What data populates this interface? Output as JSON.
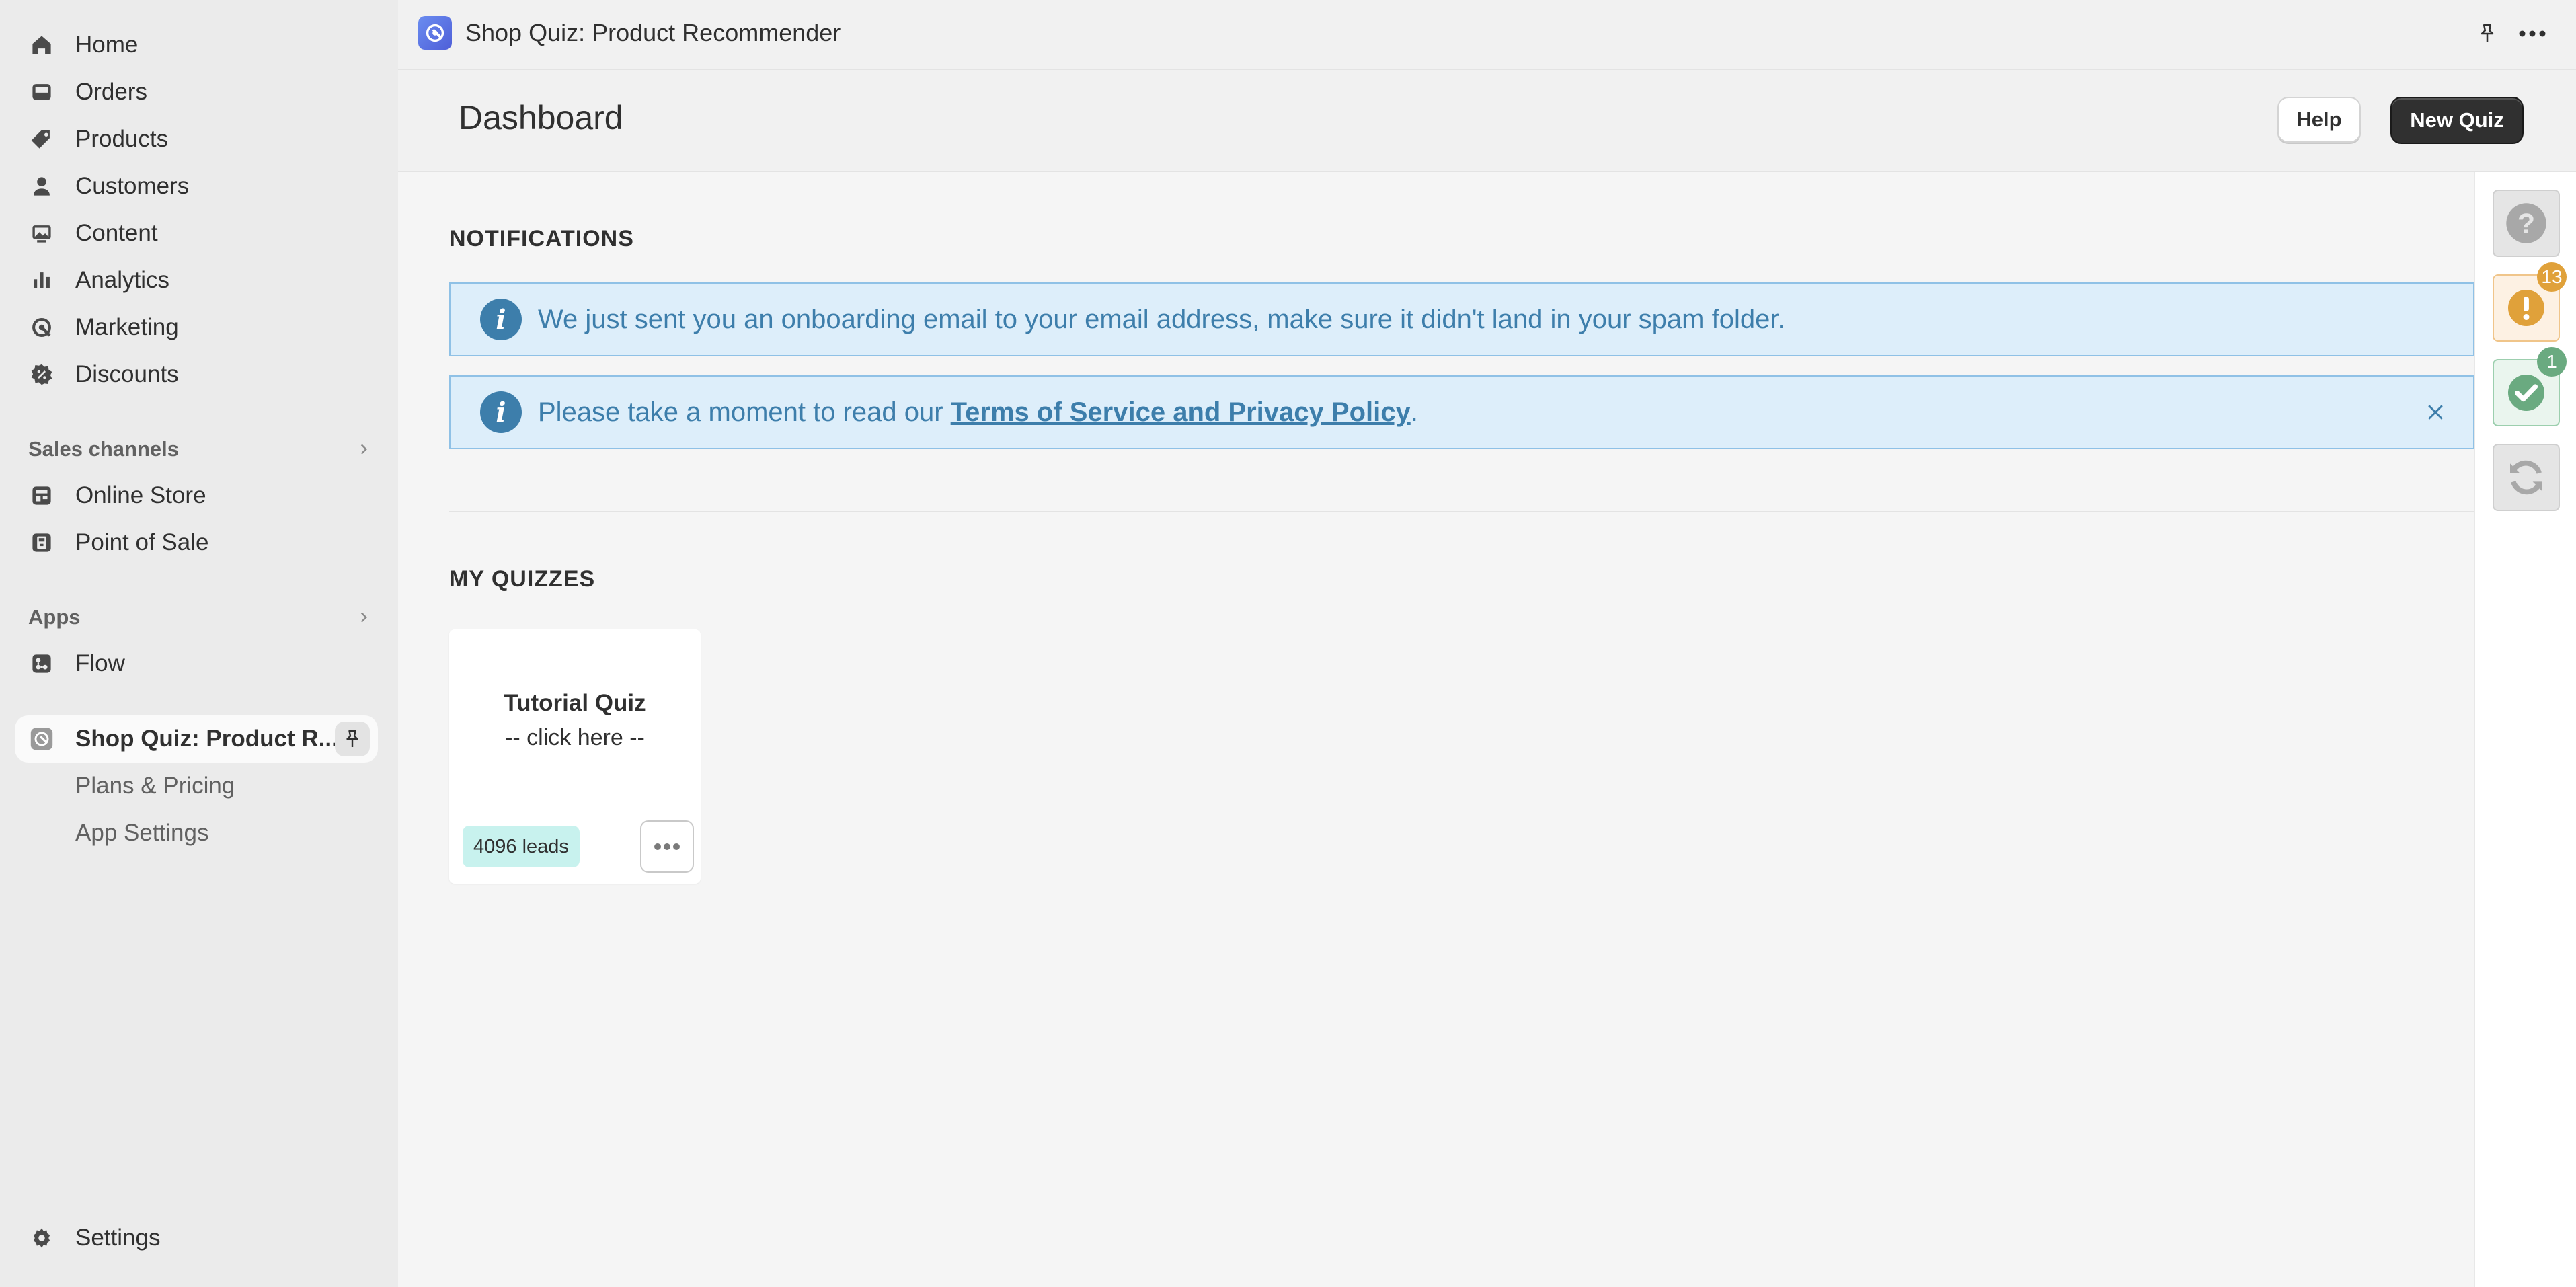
{
  "sidebar": {
    "nav": [
      {
        "label": "Home",
        "icon": "home-icon"
      },
      {
        "label": "Orders",
        "icon": "inbox-icon"
      },
      {
        "label": "Products",
        "icon": "tag-icon"
      },
      {
        "label": "Customers",
        "icon": "person-icon"
      },
      {
        "label": "Content",
        "icon": "image-icon"
      },
      {
        "label": "Analytics",
        "icon": "bar-chart-icon"
      },
      {
        "label": "Marketing",
        "icon": "target-icon"
      },
      {
        "label": "Discounts",
        "icon": "discount-icon"
      }
    ],
    "sales_channels": {
      "heading": "Sales channels",
      "items": [
        {
          "label": "Online Store",
          "icon": "store-icon"
        },
        {
          "label": "Point of Sale",
          "icon": "pos-icon"
        }
      ]
    },
    "apps": {
      "heading": "Apps",
      "items": [
        {
          "label": "Flow",
          "icon": "flow-icon"
        }
      ]
    },
    "current_app": {
      "label": "Shop Quiz: Product R...",
      "subitems": [
        {
          "label": "Plans & Pricing"
        },
        {
          "label": "App Settings"
        }
      ]
    },
    "settings_label": "Settings"
  },
  "topbar": {
    "app_title": "Shop Quiz: Product Recommender"
  },
  "header": {
    "title": "Dashboard",
    "help_label": "Help",
    "new_quiz_label": "New Quiz"
  },
  "notifications": {
    "heading": "NOTIFICATIONS",
    "items": [
      {
        "text": "We just sent you an onboarding email to your email address, make sure it didn't land in your spam folder."
      },
      {
        "prefix": "Please take a moment to read our ",
        "link": "Terms of Service and Privacy Policy",
        "suffix": "."
      }
    ]
  },
  "quizzes": {
    "heading": "MY QUIZZES",
    "items": [
      {
        "name": "Tutorial Quiz",
        "cta": "-- click here --",
        "leads": "4096 leads"
      }
    ]
  },
  "rail": {
    "warnings_count": "13",
    "success_count": "1",
    "colors": {
      "warning": "#e0a13a",
      "success": "#6aaa80",
      "neutral": "#a8a8a8"
    }
  },
  "colors": {
    "info_bg": "#ddeefa",
    "info_text": "#3d7eab",
    "primary_button": "#303030",
    "leads_badge": "#c8f2ee"
  }
}
